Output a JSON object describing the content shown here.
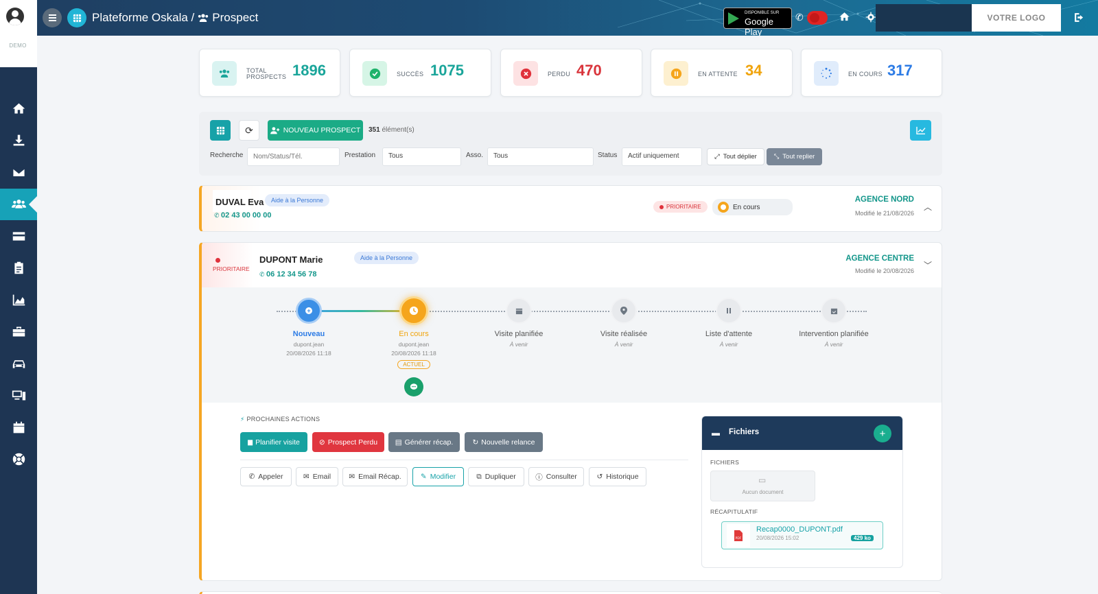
{
  "sidebar": {
    "demo_label": "DEMO",
    "items": [
      {
        "name": "home",
        "active": false
      },
      {
        "name": "download",
        "active": false
      },
      {
        "name": "mail",
        "active": false
      },
      {
        "name": "users",
        "active": true
      },
      {
        "name": "card",
        "active": false
      },
      {
        "name": "clipboard",
        "active": false
      },
      {
        "name": "chart-area",
        "active": false
      },
      {
        "name": "toolbox",
        "active": false
      },
      {
        "name": "car",
        "active": false
      },
      {
        "name": "devices",
        "active": false
      },
      {
        "name": "calendar",
        "active": false
      },
      {
        "name": "support",
        "active": false
      }
    ]
  },
  "header": {
    "title_prefix": "Plateforme Oskala /",
    "title_page": "Prospect",
    "gplay_small": "DISPONIBLE SUR",
    "gplay_big": "Google Play",
    "logo": "VOTRE LOGO"
  },
  "stats": [
    {
      "label1": "TOTAL",
      "label2": "PROSPECTS",
      "value": "1896",
      "color": "#1aa59a",
      "bg": "#d9f3f1"
    },
    {
      "label1": "SUCCÈS",
      "label2": "",
      "value": "1075",
      "color": "#1aa59a",
      "bg": "#d6f5e6"
    },
    {
      "label1": "PERDU",
      "label2": "",
      "value": "470",
      "color": "#d9343b",
      "bg": "#fde2e3"
    },
    {
      "label1": "EN ATTENTE",
      "label2": "",
      "value": "34",
      "color": "#f0a30a",
      "bg": "#fdf0d0"
    },
    {
      "label1": "EN COURS",
      "label2": "",
      "value": "317",
      "color": "#2c7be5",
      "bg": "#e0ecfb"
    }
  ],
  "toolbar": {
    "new_prospect": "NOUVEAU PROSPECT",
    "count": "351",
    "count_suffix": "élément(s)",
    "search_label": "Recherche",
    "search_placeholder": "Nom/Status/Tél.",
    "prestation_label": "Prestation",
    "prestation_value": "Tous",
    "asso_label": "Asso.",
    "asso_value": "Tous",
    "status_label": "Status",
    "status_value": "Actif uniquement",
    "expand_all": "Tout déplier",
    "collapse_all": "Tout replier"
  },
  "prospects": [
    {
      "name": "DUVAL Eva",
      "service": "Aide à la Personne",
      "phone": "02 43 00 00 00",
      "priority": "PRIORITAIRE",
      "status": "En cours",
      "agency": "AGENCE NORD",
      "modified": "Modifié le 21/08/2026"
    },
    {
      "name": "DUPONT Marie",
      "service": "Aide à la Personne",
      "phone": "06 12 34 56 78",
      "priority": "PRIORITAIRE",
      "agency": "AGENCE CENTRE",
      "modified": "Modifié le 20/08/2026"
    }
  ],
  "timeline": [
    {
      "name": "Nouveau",
      "l1": "dupont.jean",
      "l2": "20/08/2026 11:18",
      "state": "done"
    },
    {
      "name": "En cours",
      "l1": "dupont.jean",
      "l2": "20/08/2026 11:18",
      "state": "current",
      "badge": "ACTUEL"
    },
    {
      "name": "Visite planifiée",
      "l1": "À venir",
      "l2": "",
      "state": "todo"
    },
    {
      "name": "Visite réalisée",
      "l1": "À venir",
      "l2": "",
      "state": "todo"
    },
    {
      "name": "Liste d'attente",
      "l1": "À venir",
      "l2": "",
      "state": "todo"
    },
    {
      "name": "Intervention planifiée",
      "l1": "À venir",
      "l2": "",
      "state": "todo"
    }
  ],
  "actions": {
    "heading": "PROCHAINES ACTIONS",
    "primary": [
      "Planifier visite",
      "Prospect Perdu",
      "Générer récap.",
      "Nouvelle relance"
    ],
    "secondary": [
      "Appeler",
      "Email",
      "Email Récap.",
      "Modifier",
      "Dupliquer",
      "Consulter",
      "Historique"
    ]
  },
  "files": {
    "title": "Fichiers",
    "files_label": "FICHIERS",
    "empty": "Aucun document",
    "recap_label": "RÉCAPITULATIF",
    "recap_name": "Recap0000_DUPONT.pdf",
    "recap_date": "20/08/2026 15:02",
    "recap_size": "429 ko"
  }
}
